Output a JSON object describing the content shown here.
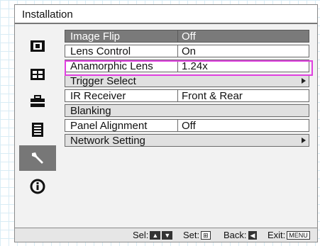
{
  "window": {
    "title": "Installation"
  },
  "sidebar": {
    "items": [
      {
        "icon": "picture-icon",
        "active": false
      },
      {
        "icon": "screen-icon",
        "active": false
      },
      {
        "icon": "toolbox-icon",
        "active": false
      },
      {
        "icon": "list-icon",
        "active": false
      },
      {
        "icon": "wrench-icon",
        "active": true
      },
      {
        "icon": "info-icon",
        "active": false
      }
    ]
  },
  "menu": {
    "rows": [
      {
        "label": "Image Flip",
        "value": "Off"
      },
      {
        "label": "Lens Control",
        "value": "On"
      },
      {
        "label": "Anamorphic Lens",
        "value": "1.24x"
      },
      {
        "label": "Trigger Select",
        "value": ""
      },
      {
        "label": "IR Receiver",
        "value": "Front & Rear"
      },
      {
        "label": "Blanking",
        "value": ""
      },
      {
        "label": "Panel Alignment",
        "value": "Off"
      },
      {
        "label": "Network Setting",
        "value": ""
      }
    ]
  },
  "footer": {
    "sel_label": "Sel:",
    "set_label": "Set:",
    "back_label": "Back:",
    "exit_label": "Exit:",
    "exit_key": "MENU"
  },
  "colors": {
    "highlight": "#e040e0",
    "selected_row": "#7a7a7a",
    "active_sidebar": "#777777"
  }
}
